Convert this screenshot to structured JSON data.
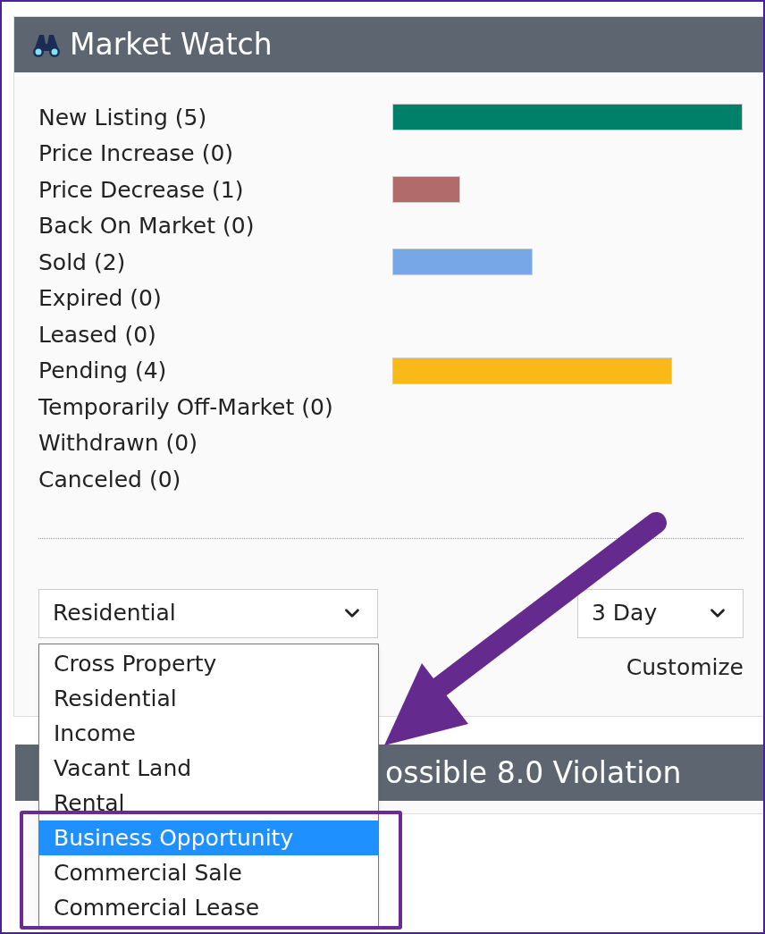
{
  "market_watch": {
    "title": "Market Watch",
    "rows": [
      {
        "label": "New Listing (5)",
        "bar": {
          "color": "#008068"
        }
      },
      {
        "label": "Price Increase (0)"
      },
      {
        "label": "Price Decrease (1)",
        "bar": {
          "color": "#b26b6b"
        }
      },
      {
        "label": "Back On Market (0)"
      },
      {
        "label": "Sold (2)",
        "bar": {
          "color": "#77a7e6"
        }
      },
      {
        "label": "Expired (0)"
      },
      {
        "label": "Leased (0)"
      },
      {
        "label": "Pending (4)",
        "bar": {
          "color": "#f9b919"
        }
      },
      {
        "label": "Temporarily Off-Market (0)"
      },
      {
        "label": "Withdrawn (0)"
      },
      {
        "label": "Canceled (0)"
      }
    ],
    "type_select": {
      "value": "Residential",
      "expanded": true,
      "options": [
        {
          "label": "Cross Property",
          "highlighted": false
        },
        {
          "label": "Residential",
          "highlighted": false
        },
        {
          "label": "Income",
          "highlighted": false
        },
        {
          "label": "Vacant Land",
          "highlighted": false
        },
        {
          "label": "Rental",
          "highlighted": false
        },
        {
          "label": "Business Opportunity",
          "highlighted": true
        },
        {
          "label": "Commercial Sale",
          "highlighted": false
        },
        {
          "label": "Commercial Lease",
          "highlighted": false
        }
      ]
    },
    "period_select": {
      "value": "3 Day"
    },
    "customize_link": "Customize"
  },
  "second_panel": {
    "title": "ossible 8.0 Violation"
  }
}
